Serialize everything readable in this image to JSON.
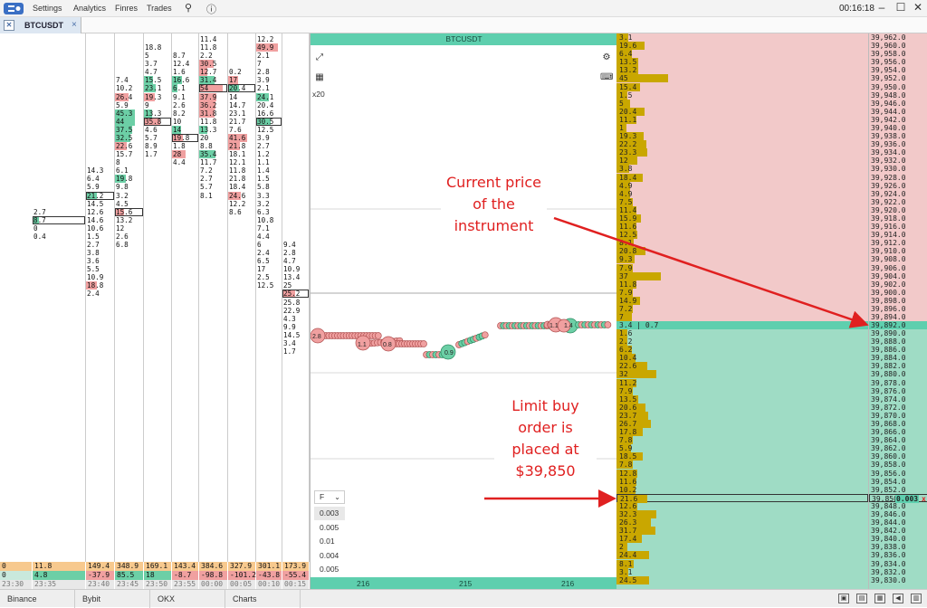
{
  "menu": {
    "items": [
      "Settings",
      "Analytics",
      "Finres",
      "Trades"
    ],
    "clock": "00:16:18"
  },
  "tab": {
    "label": "BTCUSDT",
    "close": "×"
  },
  "chart": {
    "title": "BTCUSDT",
    "zoom": "x20",
    "filter_label": "F",
    "filter_options": [
      "0.003",
      "0.005",
      "0.01",
      "0.004",
      "0.005"
    ],
    "footer": [
      "216",
      "215",
      "216"
    ]
  },
  "cluster": {
    "columns": [
      {
        "start": 21,
        "values": [
          "2.7",
          "8.7",
          "0",
          "0.4"
        ],
        "types": [
          "n",
          "g",
          "n",
          "n"
        ],
        "bars": [
          0,
          1,
          0,
          0
        ]
      },
      {
        "start": 16,
        "values": [
          "14.3",
          "6.4",
          "5.9",
          "21.2",
          "14.5",
          "12.6",
          "14.6",
          "10.6",
          "1.5",
          "2.7",
          "3.8",
          "3.6",
          "5.5",
          "10.9",
          "18.8",
          "2.4"
        ],
        "types": [
          "n",
          "n",
          "n",
          "g",
          "n",
          "n",
          "n",
          "n",
          "n",
          "n",
          "n",
          "n",
          "n",
          "n",
          "r",
          "n"
        ],
        "bars": [
          0,
          0,
          0,
          1,
          0,
          0,
          0,
          0,
          0,
          0,
          0,
          0,
          0,
          0,
          0,
          0
        ]
      },
      {
        "start": 5,
        "values": [
          "7.4",
          "10.2",
          "26.4",
          "5.9",
          "45.3",
          "44",
          "37.5",
          "32.5",
          "22.6",
          "15.7",
          "8",
          "6.1",
          "19.8",
          "9.8",
          "3.2",
          "4.5",
          "15.6",
          "13.2",
          "12",
          "2.6",
          "6.8"
        ],
        "types": [
          "n",
          "n",
          "r",
          "n",
          "g",
          "g",
          "g",
          "g",
          "r",
          "n",
          "n",
          "n",
          "g",
          "n",
          "n",
          "n",
          "r",
          "n",
          "n",
          "n",
          "n"
        ],
        "bars": [
          0,
          0,
          0,
          0,
          0,
          0,
          0,
          0,
          0,
          0,
          0,
          0,
          0,
          0,
          0,
          0,
          1,
          0,
          0,
          0,
          0
        ]
      },
      {
        "start": 1,
        "values": [
          "18.8",
          "5",
          "3.7",
          "4.7",
          "15.5",
          "23.1",
          "19.3",
          "9",
          "13.3",
          "35.8",
          "4.6",
          "5.7",
          "8.9",
          "1.7"
        ],
        "types": [
          "n",
          "n",
          "n",
          "n",
          "g",
          "g",
          "r",
          "n",
          "g",
          "r",
          "n",
          "n",
          "n",
          "n"
        ],
        "bars": [
          0,
          0,
          0,
          0,
          0,
          0,
          0,
          0,
          0,
          1,
          0,
          0,
          0,
          0
        ]
      },
      {
        "start": 2,
        "values": [
          "8.7",
          "12.4",
          "1.6",
          "16.6",
          "6.1",
          "9.1",
          "2.6",
          "8.2",
          "10",
          "14",
          "19.8",
          "1.8",
          "28",
          "4.4"
        ],
        "types": [
          "n",
          "n",
          "n",
          "g",
          "g",
          "n",
          "n",
          "n",
          "n",
          "g",
          "r",
          "n",
          "r",
          "n"
        ],
        "bars": [
          0,
          0,
          0,
          0,
          0,
          0,
          0,
          0,
          0,
          0,
          1,
          0,
          0,
          0
        ]
      },
      {
        "start": 0,
        "values": [
          "11.4",
          "11.8",
          "2.2",
          "30.5",
          "12.7",
          "31.4",
          "54",
          "37.9",
          "36.2",
          "31.8",
          "11.8",
          "13.3",
          "20",
          "8.8",
          "35.4",
          "11.7",
          "7.2",
          "2.7",
          "5.7",
          "8.1"
        ],
        "types": [
          "n",
          "n",
          "n",
          "r",
          "r",
          "g",
          "r",
          "r",
          "r",
          "r",
          "n",
          "g",
          "n",
          "n",
          "g",
          "n",
          "n",
          "n",
          "n",
          "n"
        ],
        "bars": [
          0,
          0,
          0,
          0,
          0,
          0,
          1,
          0,
          0,
          0,
          0,
          0,
          0,
          0,
          0,
          0,
          0,
          0,
          0,
          0
        ]
      },
      {
        "start": 4,
        "values": [
          "0.2",
          "17",
          "20.4",
          "14",
          "14.7",
          "23.1",
          "21.7",
          "7.6",
          "41.6",
          "21.8",
          "18.1",
          "12.1",
          "11.8",
          "21.8",
          "18.4",
          "24.6",
          "12.2",
          "8.6"
        ],
        "types": [
          "n",
          "r",
          "g",
          "n",
          "n",
          "n",
          "n",
          "n",
          "r",
          "r",
          "n",
          "n",
          "n",
          "n",
          "n",
          "r",
          "n",
          "n"
        ],
        "bars": [
          0,
          0,
          1,
          0,
          0,
          0,
          0,
          0,
          0,
          0,
          0,
          0,
          0,
          0,
          0,
          0,
          0,
          0
        ]
      },
      {
        "start": 0,
        "values": [
          "12.2",
          "49.9",
          "2.1",
          "7",
          "2.8",
          "3.9",
          "2.1",
          "24.1",
          "20.4",
          "16.6",
          "30.5",
          "12.5",
          "3.9",
          "2.7",
          "1.2",
          "1.1",
          "1.4",
          "1.5",
          "5.8",
          "3.3",
          "3.2",
          "6.3",
          "10.8",
          "7.1",
          "4.4",
          "6",
          "2.4",
          "6.5",
          "17",
          "2.5",
          "12.5"
        ],
        "types": [
          "n",
          "r",
          "n",
          "n",
          "n",
          "n",
          "n",
          "g",
          "n",
          "n",
          "g",
          "n",
          "n",
          "n",
          "n",
          "n",
          "n",
          "n",
          "n",
          "n",
          "n",
          "n",
          "n",
          "n",
          "n",
          "n",
          "n",
          "n",
          "n",
          "n",
          "n"
        ],
        "bars": [
          0,
          0,
          0,
          0,
          0,
          0,
          0,
          0,
          0,
          0,
          1,
          0,
          0,
          0,
          0,
          0,
          0,
          0,
          0,
          0,
          0,
          0,
          0,
          0,
          0,
          0,
          0,
          0,
          0,
          0,
          0
        ]
      },
      {
        "start": 25,
        "values": [
          "9.4",
          "2.8",
          "4.7",
          "10.9",
          "13.4",
          "25",
          "25.2",
          "25.8",
          "22.9",
          "4.3",
          "9.9",
          "14.5",
          "3.4",
          "1.7"
        ],
        "types": [
          "n",
          "n",
          "n",
          "n",
          "n",
          "n",
          "r",
          "n",
          "n",
          "n",
          "n",
          "n",
          "n",
          "n"
        ],
        "bars": [
          0,
          0,
          0,
          0,
          0,
          0,
          1,
          0,
          0,
          0,
          0,
          0,
          0,
          0
        ]
      }
    ],
    "totals": {
      "row1": [
        "0",
        "11.8",
        "149.4",
        "348.9",
        "169.1",
        "143.4",
        "384.6",
        "327.9",
        "301.1",
        "173.9"
      ],
      "row2": [
        "0",
        "4.8",
        "-37.9",
        "85.5",
        "18",
        "-8.7",
        "-98.8",
        "-101.2",
        "-43.8",
        "-55.4"
      ],
      "times": [
        "23:30",
        "23:35",
        "23:40",
        "23:45",
        "23:50",
        "23:55",
        "00:00",
        "00:05",
        "00:10",
        "00:15"
      ]
    }
  },
  "book": {
    "asks": [
      "3.1",
      "19.6",
      "6.4",
      "13.5",
      "13.2",
      "45",
      "15.4",
      "1.5",
      "5",
      "20.4",
      "11.1",
      "1",
      "19.3",
      "22.2",
      "23.3",
      "12",
      "3.8",
      "18.4",
      "4.9",
      "4.9",
      "7.5",
      "11.4",
      "15.9",
      "11.6",
      "12.5",
      "8.1",
      "20.8",
      "9.3",
      "7.9",
      "37",
      "11.8",
      "7.9",
      "14.9",
      "7.2",
      "7"
    ],
    "current": "3.4 | 0.7",
    "bids": [
      "1.6",
      "2.2",
      "6.2",
      "10.4",
      "22.6",
      "32",
      "11.2",
      "7.9",
      "13.5",
      "20.6",
      "23.7",
      "26.7",
      "17.8",
      "7.8",
      "5.9",
      "18.5",
      "7.8",
      "12.8",
      "11.6",
      "10.2",
      "21.6",
      "12.6",
      "32.3",
      "26.3",
      "31.7",
      "17.4",
      "2",
      "24.4",
      "8.1",
      "3.1",
      "24.5"
    ],
    "order_qty": "0.003",
    "order_cancel": "x"
  },
  "prices": {
    "asks": [
      "39,962.0",
      "39,960.0",
      "39,958.0",
      "39,956.0",
      "39,954.0",
      "39,952.0",
      "39,950.0",
      "39,948.0",
      "39,946.0",
      "39,944.0",
      "39,942.0",
      "39,940.0",
      "39,938.0",
      "39,936.0",
      "39,934.0",
      "39,932.0",
      "39,930.0",
      "39,928.0",
      "39,926.0",
      "39,924.0",
      "39,922.0",
      "39,920.0",
      "39,918.0",
      "39,916.0",
      "39,914.0",
      "39,912.0",
      "39,910.0",
      "39,908.0",
      "39,906.0",
      "39,904.0",
      "39,902.0",
      "39,900.0",
      "39,898.0",
      "39,896.0",
      "39,894.0"
    ],
    "current": "39,892.0",
    "bids": [
      "39,890.0",
      "39,888.0",
      "39,886.0",
      "39,884.0",
      "39,882.0",
      "39,880.0",
      "39,878.0",
      "39,876.0",
      "39,874.0",
      "39,872.0",
      "39,870.0",
      "39,868.0",
      "39,866.0",
      "39,864.0",
      "39,862.0",
      "39,860.0",
      "39,858.0",
      "39,856.0",
      "39,854.0",
      "39,852.0",
      "39,850.0",
      "39,848.0",
      "39,846.0",
      "39,844.0",
      "39,842.0",
      "39,840.0",
      "39,838.0",
      "39,836.0",
      "39,834.0",
      "39,832.0",
      "39,830.0"
    ]
  },
  "annotations": {
    "current_price": [
      "Current price",
      "of the",
      "instrument"
    ],
    "limit_order": [
      "Limit buy",
      "order is",
      "placed at",
      "$39,850"
    ]
  },
  "status": {
    "tabs": [
      "Binance",
      "Bybit",
      "OKX",
      "Charts"
    ]
  },
  "colors": {
    "accent": "#5ecfae",
    "ask_bg": "#f2c9c9",
    "bid_bg": "#9fdcc5",
    "bar": "#c9a700",
    "sell": "#f0a0a0",
    "buy": "#6ccfa6",
    "arrow": "#e02020"
  }
}
